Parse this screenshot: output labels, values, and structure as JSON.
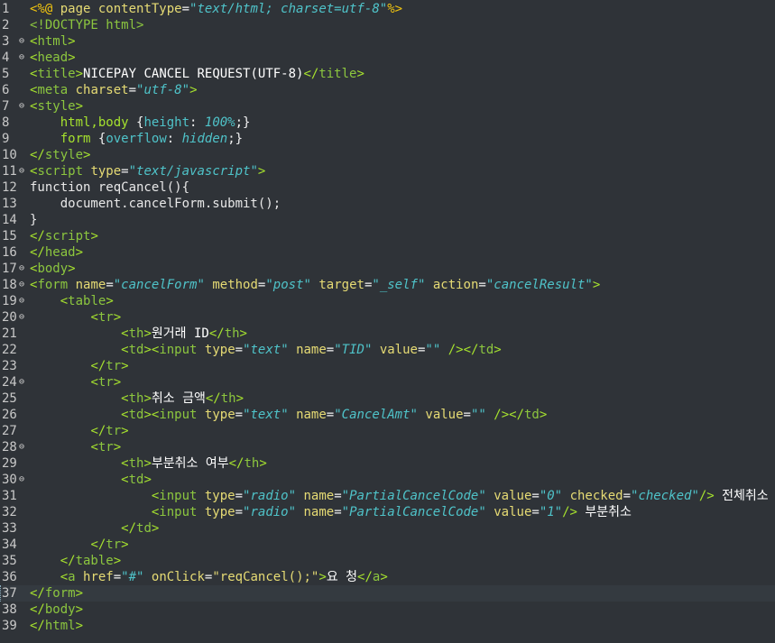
{
  "editor": {
    "lines": [
      {
        "n": "1",
        "fold": "",
        "tokens": [
          [
            "jsp",
            "<%@ "
          ],
          [
            "at",
            "page "
          ],
          [
            "at",
            "contentType"
          ],
          [
            "p",
            "="
          ],
          [
            "v",
            "\"text/html; charset=utf-8\""
          ],
          [
            "jsp",
            "%>"
          ]
        ]
      },
      {
        "n": "2",
        "fold": "",
        "tokens": [
          [
            "tg",
            "<!DOCTYPE "
          ],
          [
            "tg",
            "html"
          ],
          [
            "tg",
            ">"
          ]
        ]
      },
      {
        "n": "3",
        "fold": "⊖",
        "tokens": [
          [
            "br",
            "<"
          ],
          [
            "tg",
            "html"
          ],
          [
            "br",
            ">"
          ]
        ]
      },
      {
        "n": "4",
        "fold": "⊖",
        "tokens": [
          [
            "br",
            "<"
          ],
          [
            "tg",
            "head"
          ],
          [
            "br",
            ">"
          ]
        ]
      },
      {
        "n": "5",
        "fold": "",
        "tokens": [
          [
            "br",
            "<"
          ],
          [
            "tg",
            "title"
          ],
          [
            "br",
            ">"
          ],
          [
            "txt",
            "NICEPAY CANCEL REQUEST(UTF-8)"
          ],
          [
            "br",
            "</"
          ],
          [
            "tg",
            "title"
          ],
          [
            "br",
            ">"
          ]
        ]
      },
      {
        "n": "6",
        "fold": "",
        "tokens": [
          [
            "br",
            "<"
          ],
          [
            "tg",
            "meta "
          ],
          [
            "at",
            "charset"
          ],
          [
            "p",
            "="
          ],
          [
            "v",
            "\"utf-8\""
          ],
          [
            "br",
            ">"
          ]
        ]
      },
      {
        "n": "7",
        "fold": "⊖",
        "tokens": [
          [
            "br",
            "<"
          ],
          [
            "tg",
            "style"
          ],
          [
            "br",
            ">"
          ]
        ]
      },
      {
        "n": "8",
        "fold": "",
        "tokens": [
          [
            "p",
            "    "
          ],
          [
            "css",
            "html,body "
          ],
          [
            "p",
            "{"
          ],
          [
            "cp",
            "height"
          ],
          [
            "p",
            ": "
          ],
          [
            "cv",
            "100%"
          ],
          [
            "p",
            ";}"
          ]
        ]
      },
      {
        "n": "9",
        "fold": "",
        "tokens": [
          [
            "p",
            "    "
          ],
          [
            "css",
            "form "
          ],
          [
            "p",
            "{"
          ],
          [
            "cp",
            "overflow"
          ],
          [
            "p",
            ": "
          ],
          [
            "cv",
            "hidden"
          ],
          [
            "p",
            ";}"
          ]
        ]
      },
      {
        "n": "10",
        "fold": "",
        "tokens": [
          [
            "br",
            "</"
          ],
          [
            "tg",
            "style"
          ],
          [
            "br",
            ">"
          ]
        ]
      },
      {
        "n": "11",
        "fold": "⊖",
        "tokens": [
          [
            "br",
            "<"
          ],
          [
            "tg",
            "script "
          ],
          [
            "at",
            "type"
          ],
          [
            "p",
            "="
          ],
          [
            "v",
            "\"text/javascript\""
          ],
          [
            "br",
            ">"
          ]
        ]
      },
      {
        "n": "12",
        "fold": "",
        "tokens": [
          [
            "kw",
            "function reqCancel(){"
          ]
        ]
      },
      {
        "n": "13",
        "fold": "",
        "tokens": [
          [
            "kw",
            "    document.cancelForm.submit();"
          ]
        ]
      },
      {
        "n": "14",
        "fold": "",
        "tokens": [
          [
            "kw",
            "}"
          ]
        ]
      },
      {
        "n": "15",
        "fold": "",
        "tokens": [
          [
            "br",
            "</"
          ],
          [
            "tg",
            "script"
          ],
          [
            "br",
            ">"
          ]
        ]
      },
      {
        "n": "16",
        "fold": "",
        "tokens": [
          [
            "br",
            "</"
          ],
          [
            "tg",
            "head"
          ],
          [
            "br",
            ">"
          ]
        ]
      },
      {
        "n": "17",
        "fold": "⊖",
        "tokens": [
          [
            "br",
            "<"
          ],
          [
            "tg",
            "body"
          ],
          [
            "br",
            ">"
          ]
        ]
      },
      {
        "n": "18",
        "fold": "⊖",
        "tokens": [
          [
            "br",
            "<"
          ],
          [
            "tg",
            "form "
          ],
          [
            "at",
            "name"
          ],
          [
            "p",
            "="
          ],
          [
            "v",
            "\"cancelForm\""
          ],
          [
            "p",
            " "
          ],
          [
            "at",
            "method"
          ],
          [
            "p",
            "="
          ],
          [
            "v",
            "\"post\""
          ],
          [
            "p",
            " "
          ],
          [
            "at",
            "target"
          ],
          [
            "p",
            "="
          ],
          [
            "v",
            "\"_self\""
          ],
          [
            "p",
            " "
          ],
          [
            "at",
            "action"
          ],
          [
            "p",
            "="
          ],
          [
            "v",
            "\"cancelResult\""
          ],
          [
            "br",
            ">"
          ]
        ]
      },
      {
        "n": "19",
        "fold": "⊖",
        "tokens": [
          [
            "p",
            "    "
          ],
          [
            "br",
            "<"
          ],
          [
            "tg",
            "table"
          ],
          [
            "br",
            ">"
          ]
        ]
      },
      {
        "n": "20",
        "fold": "⊖",
        "tokens": [
          [
            "p",
            "        "
          ],
          [
            "br",
            "<"
          ],
          [
            "tg",
            "tr"
          ],
          [
            "br",
            ">"
          ]
        ]
      },
      {
        "n": "21",
        "fold": "",
        "tokens": [
          [
            "p",
            "            "
          ],
          [
            "br",
            "<"
          ],
          [
            "tg",
            "th"
          ],
          [
            "br",
            ">"
          ],
          [
            "txt",
            "원거래 ID"
          ],
          [
            "br",
            "</"
          ],
          [
            "tg",
            "th"
          ],
          [
            "br",
            ">"
          ]
        ]
      },
      {
        "n": "22",
        "fold": "",
        "tokens": [
          [
            "p",
            "            "
          ],
          [
            "br",
            "<"
          ],
          [
            "tg",
            "td"
          ],
          [
            "br",
            ">"
          ],
          [
            "br",
            "<"
          ],
          [
            "tg",
            "input "
          ],
          [
            "at",
            "type"
          ],
          [
            "p",
            "="
          ],
          [
            "v",
            "\"text\""
          ],
          [
            "p",
            " "
          ],
          [
            "at",
            "name"
          ],
          [
            "p",
            "="
          ],
          [
            "v",
            "\"TID\""
          ],
          [
            "p",
            " "
          ],
          [
            "at",
            "value"
          ],
          [
            "p",
            "="
          ],
          [
            "v",
            "\"\""
          ],
          [
            "p",
            " "
          ],
          [
            "br",
            "/>"
          ],
          [
            "br",
            "</"
          ],
          [
            "tg",
            "td"
          ],
          [
            "br",
            ">"
          ]
        ]
      },
      {
        "n": "23",
        "fold": "",
        "tokens": [
          [
            "p",
            "        "
          ],
          [
            "br",
            "</"
          ],
          [
            "tg",
            "tr"
          ],
          [
            "br",
            ">"
          ]
        ]
      },
      {
        "n": "24",
        "fold": "⊖",
        "tokens": [
          [
            "p",
            "        "
          ],
          [
            "br",
            "<"
          ],
          [
            "tg",
            "tr"
          ],
          [
            "br",
            ">"
          ]
        ]
      },
      {
        "n": "25",
        "fold": "",
        "tokens": [
          [
            "p",
            "            "
          ],
          [
            "br",
            "<"
          ],
          [
            "tg",
            "th"
          ],
          [
            "br",
            ">"
          ],
          [
            "txt",
            "취소 금액"
          ],
          [
            "br",
            "</"
          ],
          [
            "tg",
            "th"
          ],
          [
            "br",
            ">"
          ]
        ]
      },
      {
        "n": "26",
        "fold": "",
        "tokens": [
          [
            "p",
            "            "
          ],
          [
            "br",
            "<"
          ],
          [
            "tg",
            "td"
          ],
          [
            "br",
            ">"
          ],
          [
            "br",
            "<"
          ],
          [
            "tg",
            "input "
          ],
          [
            "at",
            "type"
          ],
          [
            "p",
            "="
          ],
          [
            "v",
            "\"text\""
          ],
          [
            "p",
            " "
          ],
          [
            "at",
            "name"
          ],
          [
            "p",
            "="
          ],
          [
            "v",
            "\"CancelAmt\""
          ],
          [
            "p",
            " "
          ],
          [
            "at",
            "value"
          ],
          [
            "p",
            "="
          ],
          [
            "v",
            "\"\""
          ],
          [
            "p",
            " "
          ],
          [
            "br",
            "/>"
          ],
          [
            "br",
            "</"
          ],
          [
            "tg",
            "td"
          ],
          [
            "br",
            ">"
          ]
        ]
      },
      {
        "n": "27",
        "fold": "",
        "tokens": [
          [
            "p",
            "        "
          ],
          [
            "br",
            "</"
          ],
          [
            "tg",
            "tr"
          ],
          [
            "br",
            ">"
          ]
        ]
      },
      {
        "n": "28",
        "fold": "⊖",
        "tokens": [
          [
            "p",
            "        "
          ],
          [
            "br",
            "<"
          ],
          [
            "tg",
            "tr"
          ],
          [
            "br",
            ">"
          ]
        ]
      },
      {
        "n": "29",
        "fold": "",
        "tokens": [
          [
            "p",
            "            "
          ],
          [
            "br",
            "<"
          ],
          [
            "tg",
            "th"
          ],
          [
            "br",
            ">"
          ],
          [
            "txt",
            "부분취소 여부"
          ],
          [
            "br",
            "</"
          ],
          [
            "tg",
            "th"
          ],
          [
            "br",
            ">"
          ]
        ]
      },
      {
        "n": "30",
        "fold": "⊖",
        "tokens": [
          [
            "p",
            "            "
          ],
          [
            "br",
            "<"
          ],
          [
            "tg",
            "td"
          ],
          [
            "br",
            ">"
          ]
        ]
      },
      {
        "n": "31",
        "fold": "",
        "tokens": [
          [
            "p",
            "                "
          ],
          [
            "br",
            "<"
          ],
          [
            "tg",
            "input "
          ],
          [
            "at",
            "type"
          ],
          [
            "p",
            "="
          ],
          [
            "v",
            "\"radio\""
          ],
          [
            "p",
            " "
          ],
          [
            "at",
            "name"
          ],
          [
            "p",
            "="
          ],
          [
            "v",
            "\"PartialCancelCode\""
          ],
          [
            "p",
            " "
          ],
          [
            "at",
            "value"
          ],
          [
            "p",
            "="
          ],
          [
            "v",
            "\"0\""
          ],
          [
            "p",
            " "
          ],
          [
            "at",
            "checked"
          ],
          [
            "p",
            "="
          ],
          [
            "v",
            "\"checked\""
          ],
          [
            "br",
            "/>"
          ],
          [
            "txt",
            " 전체취소"
          ]
        ]
      },
      {
        "n": "32",
        "fold": "",
        "tokens": [
          [
            "p",
            "                "
          ],
          [
            "br",
            "<"
          ],
          [
            "tg",
            "input "
          ],
          [
            "at",
            "type"
          ],
          [
            "p",
            "="
          ],
          [
            "v",
            "\"radio\""
          ],
          [
            "p",
            " "
          ],
          [
            "at",
            "name"
          ],
          [
            "p",
            "="
          ],
          [
            "v",
            "\"PartialCancelCode\""
          ],
          [
            "p",
            " "
          ],
          [
            "at",
            "value"
          ],
          [
            "p",
            "="
          ],
          [
            "v",
            "\"1\""
          ],
          [
            "br",
            "/>"
          ],
          [
            "txt",
            " 부분취소"
          ]
        ]
      },
      {
        "n": "33",
        "fold": "",
        "tokens": [
          [
            "p",
            "            "
          ],
          [
            "br",
            "</"
          ],
          [
            "tg",
            "td"
          ],
          [
            "br",
            ">"
          ]
        ]
      },
      {
        "n": "34",
        "fold": "",
        "tokens": [
          [
            "p",
            "        "
          ],
          [
            "br",
            "</"
          ],
          [
            "tg",
            "tr"
          ],
          [
            "br",
            ">"
          ]
        ]
      },
      {
        "n": "35",
        "fold": "",
        "tokens": [
          [
            "p",
            "    "
          ],
          [
            "br",
            "</"
          ],
          [
            "tg",
            "table"
          ],
          [
            "br",
            ">"
          ]
        ]
      },
      {
        "n": "36",
        "fold": "",
        "tokens": [
          [
            "p",
            "    "
          ],
          [
            "br",
            "<"
          ],
          [
            "tg",
            "a "
          ],
          [
            "at",
            "href"
          ],
          [
            "p",
            "="
          ],
          [
            "v",
            "\"#\""
          ],
          [
            "p",
            " "
          ],
          [
            "at",
            "onClick"
          ],
          [
            "p",
            "="
          ],
          [
            "at",
            "\"reqCancel();\""
          ],
          [
            "br",
            ">"
          ],
          [
            "txt",
            "요 청"
          ],
          [
            "br",
            "</"
          ],
          [
            "tg",
            "a"
          ],
          [
            "br",
            ">"
          ]
        ]
      },
      {
        "n": "37",
        "fold": "",
        "current": true,
        "tokens": [
          [
            "br",
            "</"
          ],
          [
            "tg",
            "form"
          ],
          [
            "br",
            ">"
          ]
        ]
      },
      {
        "n": "38",
        "fold": "",
        "tokens": [
          [
            "br",
            "</"
          ],
          [
            "tg",
            "body"
          ],
          [
            "br",
            ">"
          ]
        ]
      },
      {
        "n": "39",
        "fold": "",
        "tokens": [
          [
            "br",
            "</"
          ],
          [
            "tg",
            "html"
          ],
          [
            "br",
            ">"
          ]
        ]
      }
    ]
  }
}
